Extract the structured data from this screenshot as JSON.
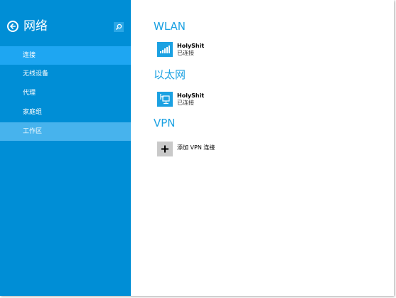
{
  "sidebar": {
    "title": "网络",
    "back_icon": "back-arrow-icon",
    "search_icon": "search-icon",
    "items": [
      {
        "label": "连接",
        "state": "selected"
      },
      {
        "label": "无线设备",
        "state": "normal"
      },
      {
        "label": "代理",
        "state": "normal"
      },
      {
        "label": "家庭组",
        "state": "normal"
      },
      {
        "label": "工作区",
        "state": "hover"
      }
    ]
  },
  "main": {
    "wlan": {
      "title": "WLAN",
      "network": {
        "name": "HolyShit",
        "status": "已连接",
        "icon": "wifi-signal-icon"
      }
    },
    "ethernet": {
      "title": "以太网",
      "network": {
        "name": "HolyShit",
        "status": "已连接",
        "icon": "ethernet-icon"
      }
    },
    "vpn": {
      "title": "VPN",
      "add_label": "添加 VPN 连接",
      "add_icon": "plus-icon"
    }
  },
  "colors": {
    "sidebar_bg": "#008ed6",
    "selected_item_bg": "#1ea6f2",
    "hover_item_bg": "#47b3ed",
    "accent": "#1ba1e2",
    "tile_grey": "#c9c9c9"
  }
}
